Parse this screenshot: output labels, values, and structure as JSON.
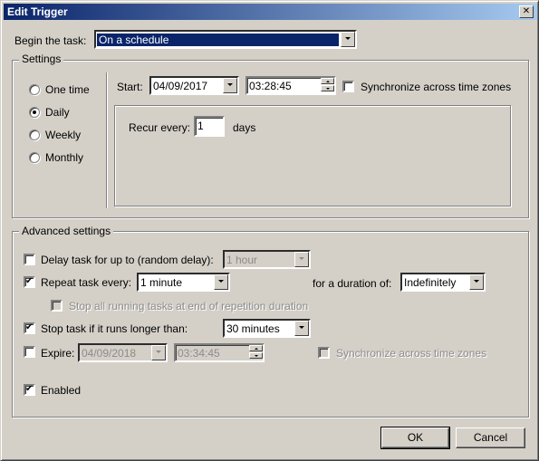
{
  "window": {
    "title": "Edit Trigger",
    "close_icon": "close-icon"
  },
  "begin": {
    "label": "Begin the task:",
    "value": "On a schedule"
  },
  "settings": {
    "legend": "Settings",
    "schedule_options": [
      {
        "label": "One time",
        "checked": false
      },
      {
        "label": "Daily",
        "checked": true
      },
      {
        "label": "Weekly",
        "checked": false
      },
      {
        "label": "Monthly",
        "checked": false
      }
    ],
    "start_label": "Start:",
    "start_date": "04/09/2017",
    "start_time": "03:28:45",
    "sync_label": "Synchronize across time zones",
    "sync_checked": false,
    "recur_label": "Recur every:",
    "recur_value": "1",
    "recur_unit": "days"
  },
  "advanced": {
    "legend": "Advanced settings",
    "delay_label": "Delay task for up to (random delay):",
    "delay_checked": false,
    "delay_value": "1 hour",
    "repeat_label": "Repeat task every:",
    "repeat_checked": true,
    "repeat_value": "1 minute",
    "duration_label": "for a duration of:",
    "duration_value": "Indefinitely",
    "stop_all_label": "Stop all running tasks at end of repetition duration",
    "stop_all_checked": false,
    "stop_label": "Stop task if it runs longer than:",
    "stop_checked": true,
    "stop_value": "30 minutes",
    "expire_label": "Expire:",
    "expire_checked": false,
    "expire_date": "04/09/2018",
    "expire_time": "03:34:45",
    "expire_sync_label": "Synchronize across time zones",
    "expire_sync_checked": false,
    "enabled_label": "Enabled",
    "enabled_checked": true
  },
  "buttons": {
    "ok": "OK",
    "cancel": "Cancel"
  }
}
